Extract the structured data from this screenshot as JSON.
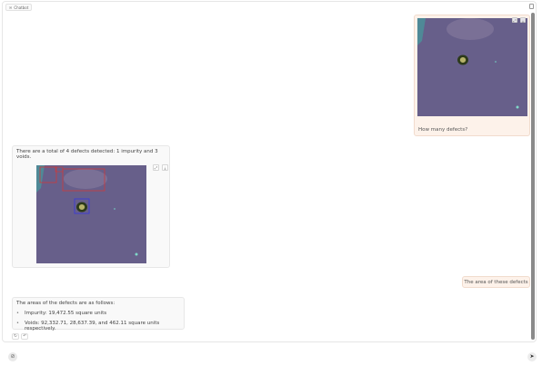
{
  "chatbot": {
    "label": "Chatbot"
  },
  "messages": {
    "user_image_caption": "How many defects?",
    "bot_summary": "There are a total of 4 defects detected: 1 impurity and 3 voids.",
    "user_followup": "The area of these defects",
    "bot_area_intro": "The areas of the defects are as follows:",
    "bot_area_items": [
      "Impurity: 19,472.55 square units",
      "Voids: 92,332.71, 28,637.39, and 462.11 square units respectively."
    ]
  },
  "icons": {
    "fullscreen": "fullscreen-icon",
    "download": "download-icon",
    "retry": "retry-icon",
    "undo": "undo-icon",
    "attach": "paperclip-icon",
    "send": "send-icon"
  },
  "colors": {
    "user_bubble": "#fdf2ea",
    "bot_bubble": "#f9f9f9",
    "impurity_box": "#3b3bd6",
    "void_box": "#d03a3a"
  },
  "input": {
    "placeholder": ""
  }
}
